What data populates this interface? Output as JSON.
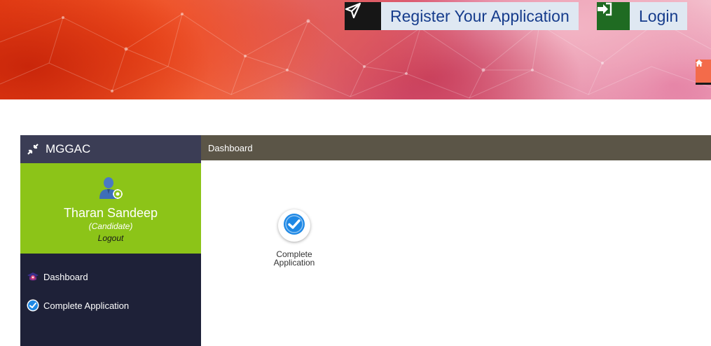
{
  "header": {
    "register_label": "Register Your Application",
    "login_label": "Login",
    "register_icon": "paper-plane-icon",
    "login_icon": "sign-in-icon",
    "home_icon": "home-icon"
  },
  "sidebar": {
    "brand": "MGGAC",
    "brand_icon": "compress-arrows-icon",
    "user_name": "Tharan Sandeep",
    "user_role": "(Candidate)",
    "logout_label": "Logout",
    "items": [
      {
        "label": "Dashboard",
        "icon": "graduation-cap-icon"
      },
      {
        "label": "Complete Application",
        "icon": "check-circle-icon"
      }
    ]
  },
  "main": {
    "title": "Dashboard",
    "tiles": [
      {
        "label_line1": "Complete",
        "label_line2": "Application",
        "icon": "check-circle-icon"
      }
    ]
  },
  "colors": {
    "sidebar_bg": "#1e2138",
    "brand_bg": "#3b3d55",
    "profile_bg": "#8cc418",
    "topstrip_bg": "#5b5547",
    "link_blue": "#163c8c",
    "login_green": "#1f6b22",
    "check_blue": "#1e88e5"
  }
}
